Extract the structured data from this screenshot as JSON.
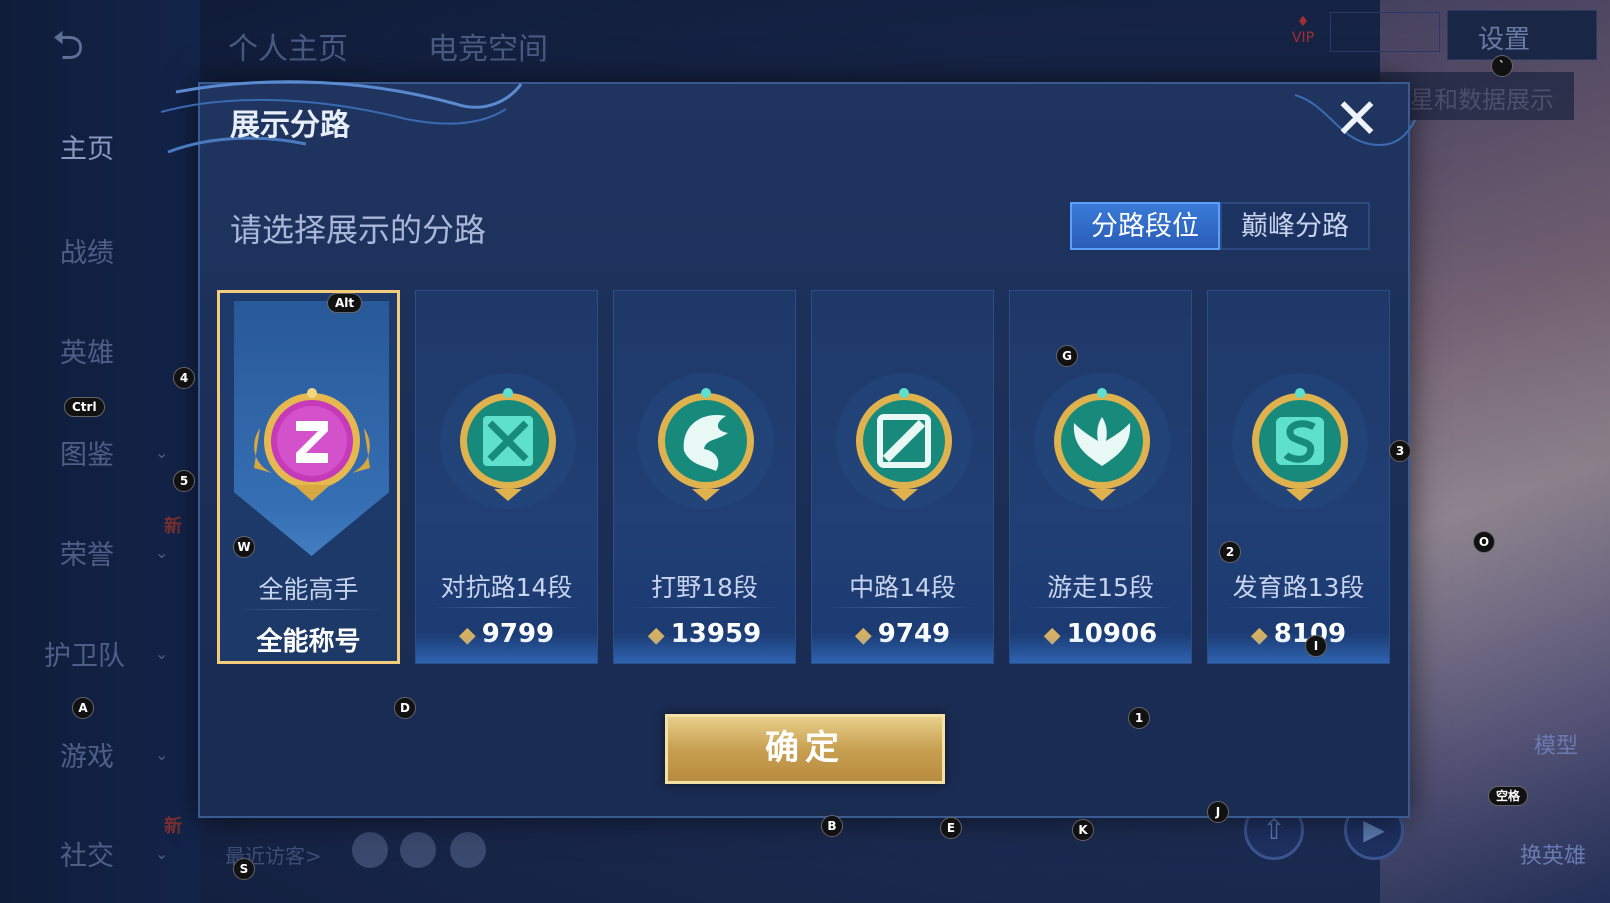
{
  "background": {
    "top_tabs": [
      "个人主页",
      "电竞空间"
    ],
    "sidebar": [
      {
        "label": "主页",
        "active": true
      },
      {
        "label": "战绩"
      },
      {
        "label": "英雄"
      },
      {
        "label": "图鉴"
      },
      {
        "label": "荣誉"
      },
      {
        "label": "护卫队"
      },
      {
        "label": "游戏"
      },
      {
        "label": "社交"
      }
    ],
    "new_badge": "新",
    "settings_label": "设置",
    "vip_label": "VIP",
    "data_strip_text": "星和数据展示",
    "recent_visitors_label": "最近访客>",
    "model_label": "模型",
    "switch_hero_label": "换英雄"
  },
  "dialog": {
    "title": "展示分路",
    "close_glyph": "✕",
    "subtitle": "请选择展示的分路",
    "segments": [
      {
        "label": "分路段位",
        "selected": true
      },
      {
        "label": "巅峰分路",
        "selected": false
      }
    ],
    "cards": [
      {
        "label": "全能高手",
        "value": "全能称号",
        "icon": "all-round-emblem-icon",
        "selected": true,
        "color": "#c03ab8"
      },
      {
        "label": "对抗路14段",
        "value": "9799",
        "icon": "clash-lane-emblem-icon",
        "selected": false,
        "color": "#1fae9e"
      },
      {
        "label": "打野18段",
        "value": "13959",
        "icon": "jungle-emblem-icon",
        "selected": false,
        "color": "#1fae9e"
      },
      {
        "label": "中路14段",
        "value": "9749",
        "icon": "mid-lane-emblem-icon",
        "selected": false,
        "color": "#1fae9e"
      },
      {
        "label": "游走15段",
        "value": "10906",
        "icon": "roam-emblem-icon",
        "selected": false,
        "color": "#1fae9e"
      },
      {
        "label": "发育路13段",
        "value": "8109",
        "icon": "farm-lane-emblem-icon",
        "selected": false,
        "color": "#1fae9e"
      }
    ],
    "confirm_label": "确定"
  },
  "hotkeys": [
    "Alt",
    "Ctrl",
    "4",
    "5",
    "W",
    "A",
    "D",
    "S",
    "G",
    "3",
    "2",
    "O",
    "I",
    "1",
    "B",
    "E",
    "K",
    "J",
    "`",
    "空格"
  ]
}
